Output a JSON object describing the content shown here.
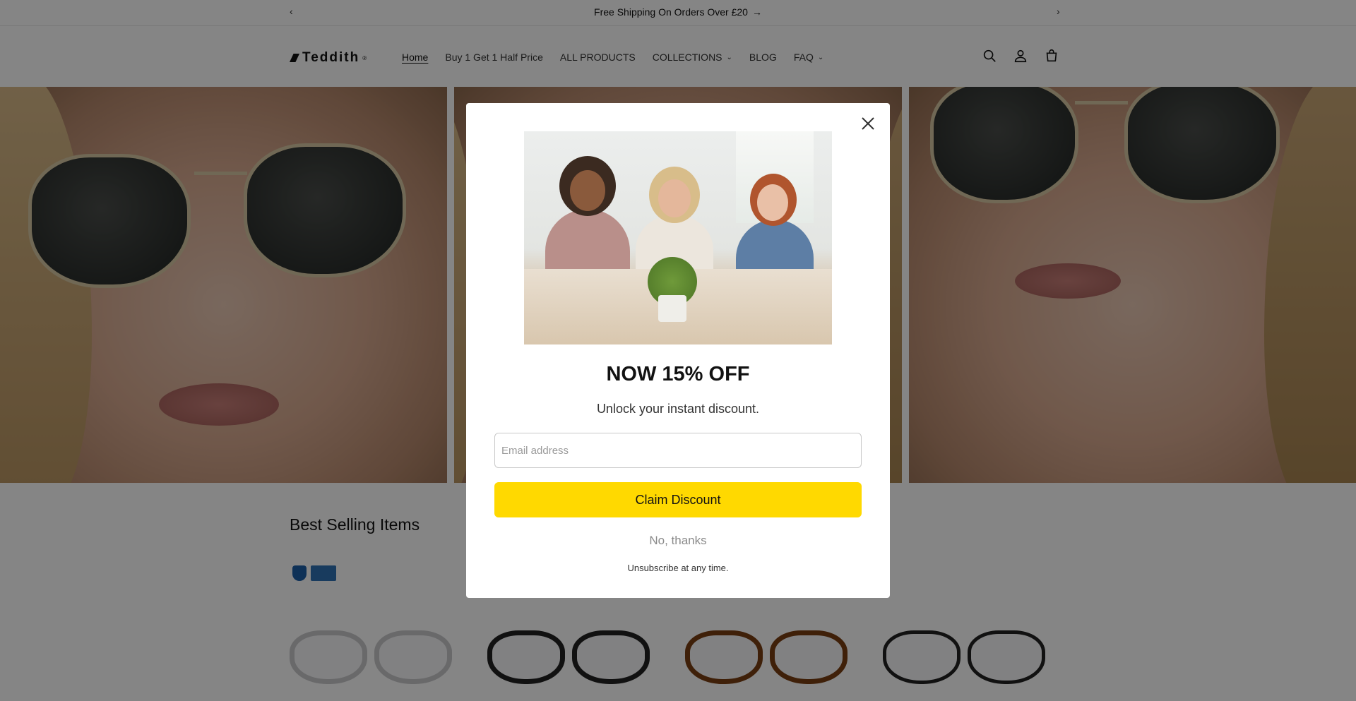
{
  "announcement": {
    "text": "Free Shipping On Orders Over £20",
    "prev_icon": "chevron-left-icon",
    "next_icon": "chevron-right-icon"
  },
  "header": {
    "logo": "Teddith",
    "nav": [
      {
        "label": "Home",
        "active": true,
        "dropdown": false
      },
      {
        "label": "Buy 1 Get 1 Half Price",
        "active": false,
        "dropdown": false
      },
      {
        "label": "ALL PRODUCTS",
        "active": false,
        "dropdown": false
      },
      {
        "label": "COLLECTIONS",
        "active": false,
        "dropdown": true
      },
      {
        "label": "BLOG",
        "active": false,
        "dropdown": false
      },
      {
        "label": "FAQ",
        "active": false,
        "dropdown": true
      }
    ],
    "icons": [
      "search-icon",
      "account-icon",
      "cart-icon"
    ]
  },
  "section": {
    "title": "Best Selling Items"
  },
  "modal": {
    "title": "NOW 15% OFF",
    "subtitle": "Unlock your instant discount.",
    "email_placeholder": "Email address",
    "email_value": "",
    "claim_label": "Claim Discount",
    "decline_label": "No, thanks",
    "footnote": "Unsubscribe at any time."
  },
  "colors": {
    "accent": "#ffd900",
    "overlay": "rgba(0,0,0,0.48)"
  }
}
